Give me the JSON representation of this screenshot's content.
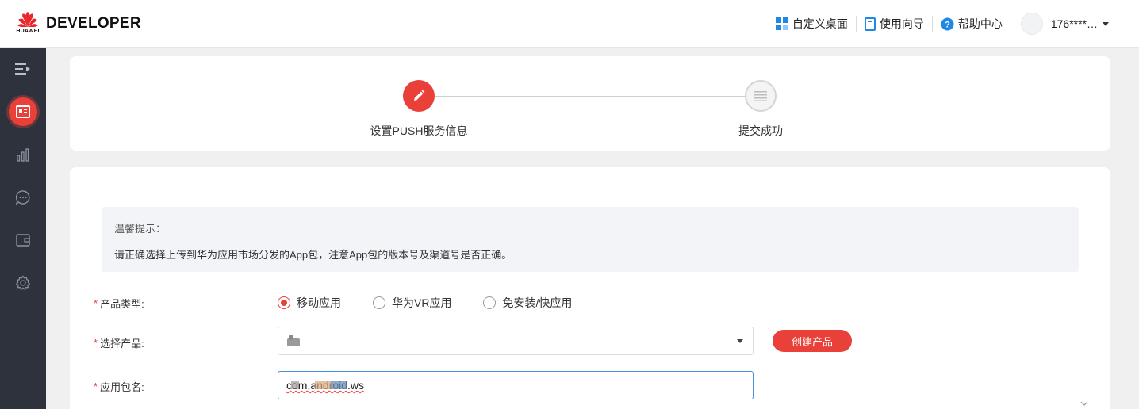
{
  "header": {
    "brand_logo_text": "HUAWEI",
    "brand_name": "DEVELOPER",
    "actions": [
      {
        "label": "自定义桌面",
        "icon": "grid-icon"
      },
      {
        "label": "使用向导",
        "icon": "guide-icon"
      },
      {
        "label": "帮助中心",
        "icon": "help-icon"
      }
    ],
    "user_name": "176****…"
  },
  "sidebar": {
    "items": [
      {
        "icon": "menu-toggle-icon",
        "active": false
      },
      {
        "icon": "app-card-icon",
        "active": true
      },
      {
        "icon": "bar-chart-icon",
        "active": false
      },
      {
        "icon": "chat-bubble-icon",
        "active": false
      },
      {
        "icon": "wallet-icon",
        "active": false
      },
      {
        "icon": "gear-icon",
        "active": false
      }
    ]
  },
  "steps": [
    {
      "label": "设置PUSH服务信息",
      "state": "active"
    },
    {
      "label": "提交成功",
      "state": "pending"
    }
  ],
  "notice": {
    "title": "温馨提示：",
    "body": "请正确选择上传到华为应用市场分发的App包，注意App包的版本号及渠道号是否正确。"
  },
  "form": {
    "product_type": {
      "label": "产品类型:",
      "options": [
        "移动应用",
        "华为VR应用",
        "免安装/快应用"
      ],
      "selected": "移动应用"
    },
    "product_select": {
      "label": "选择产品:",
      "value": "",
      "create_button": "创建产品"
    },
    "package_name": {
      "label": "应用包名:",
      "value": "com.android.ws"
    }
  },
  "colors": {
    "accent": "#e9413a",
    "sidebar_bg": "#2d323c",
    "page_bg": "#f0f0f0",
    "input_focus": "#4a90e2"
  }
}
